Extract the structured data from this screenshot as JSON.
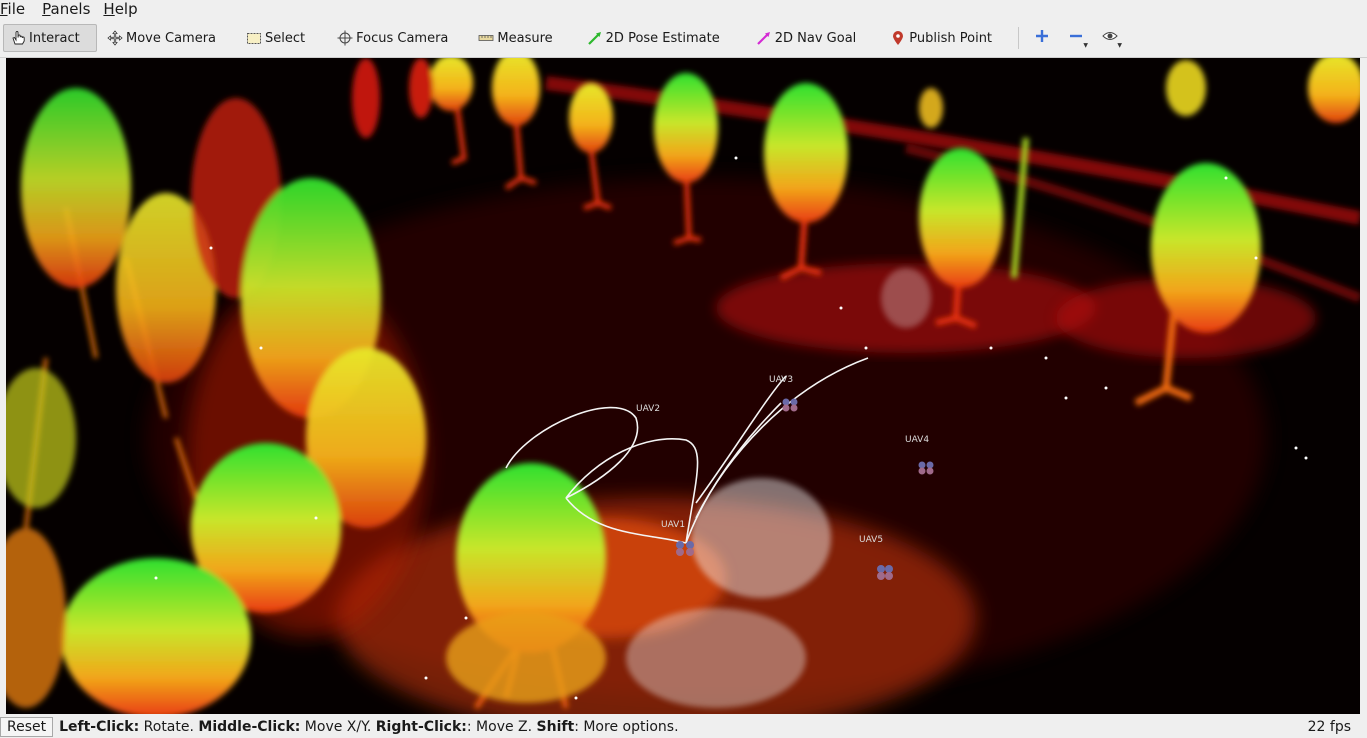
{
  "menu": {
    "items": [
      {
        "mnemonic": "F",
        "rest": "ile"
      },
      {
        "mnemonic": "P",
        "rest": "anels"
      },
      {
        "mnemonic": "H",
        "rest": "elp"
      }
    ]
  },
  "toolbar": {
    "interact": "Interact",
    "move_camera": "Move Camera",
    "select": "Select",
    "focus_camera": "Focus Camera",
    "measure": "Measure",
    "pose_estimate": "2D Pose Estimate",
    "nav_goal": "2D Nav Goal",
    "publish_point": "Publish Point",
    "active": "Interact"
  },
  "viewport": {
    "labels": {
      "uav1": "UAV1",
      "uav2": "UAV2",
      "uav3": "UAV3",
      "uav4": "UAV4",
      "uav5": "UAV5"
    },
    "colors": {
      "background": "#000000",
      "trajectory": "#ffffff"
    }
  },
  "statusbar": {
    "reset": "Reset",
    "hint1_key": "Left-Click:",
    "hint1_val": " Rotate. ",
    "hint2_key": "Middle-Click:",
    "hint2_val": " Move X/Y. ",
    "hint3_key": "Right-Click:",
    "hint3_val": ": Move Z. ",
    "hint4_key": "Shift",
    "hint4_val": ": More options.",
    "fps": "22 fps"
  }
}
